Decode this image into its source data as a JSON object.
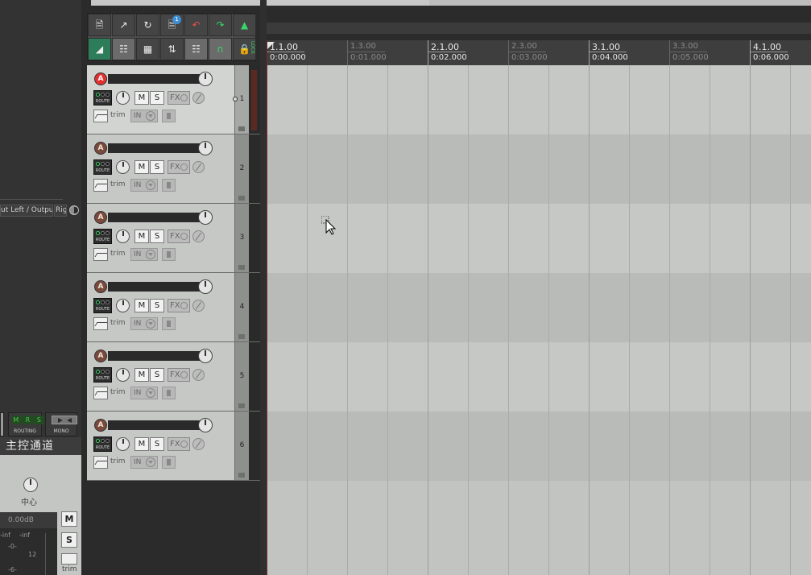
{
  "left_panel": {
    "io_output": "ut Left / Output",
    "io_right": "Rig",
    "routing_label": "ROUTING",
    "mono_label": "MONO",
    "msr_text": "M R S",
    "master_label": "主控通道",
    "pan_label": "中心",
    "volume_readout": "0.00dB",
    "meter": {
      "left": "-inf",
      "right": "-inf",
      "zero": "-0-",
      "twelve": "12",
      "minus6": "-6-"
    },
    "m_label": "M",
    "s_label": "S",
    "trim_label": "trim"
  },
  "toolbar": {
    "badge": "1",
    "vertical_label": "LOCK"
  },
  "tracks": [
    {
      "number": "1",
      "arm": "A",
      "selected": true
    },
    {
      "number": "2",
      "arm": "A",
      "selected": false
    },
    {
      "number": "3",
      "arm": "A",
      "selected": false
    },
    {
      "number": "4",
      "arm": "A",
      "selected": false
    },
    {
      "number": "5",
      "arm": "A",
      "selected": false
    },
    {
      "number": "6",
      "arm": "A",
      "selected": false
    }
  ],
  "track_labels": {
    "route": "ROUTE",
    "mute": "M",
    "solo": "S",
    "fx": "FX",
    "trim": "trim",
    "input": "IN"
  },
  "ruler": [
    {
      "beat": "1.1.00",
      "time": "0:00.000",
      "minor": false
    },
    {
      "beat": "1.3.00",
      "time": "0:01.000",
      "minor": true
    },
    {
      "beat": "2.1.00",
      "time": "0:02.000",
      "minor": false
    },
    {
      "beat": "2.3.00",
      "time": "0:03.000",
      "minor": true
    },
    {
      "beat": "3.1.00",
      "time": "0:04.000",
      "minor": false
    },
    {
      "beat": "3.3.00",
      "time": "0:05.000",
      "minor": true
    },
    {
      "beat": "4.1.00",
      "time": "0:06.000",
      "minor": false
    }
  ],
  "colors": {
    "arm_selected": "#e23030",
    "arm_default": "#7a4a3a",
    "toolbar_green": "#3bd46a",
    "route_green": "#3fd06a"
  }
}
